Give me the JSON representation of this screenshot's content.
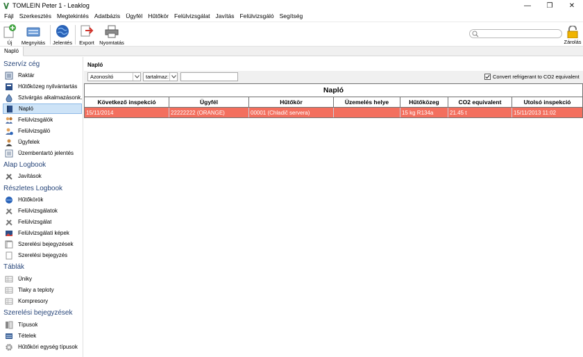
{
  "window": {
    "title": "TOMLEIN Peter 1 - Leaklog",
    "minimize": "—",
    "restore": "❐",
    "close": "✕"
  },
  "menu": [
    "Fájl",
    "Szerkesztés",
    "Megtekintés",
    "Adatbázis",
    "Ügyfél",
    "Hűtőkör",
    "Felülvizsgálat",
    "Javítás",
    "Felülvizsgáló",
    "Segítség"
  ],
  "toolbar": {
    "new_label": "Új",
    "open_label": "Megnyitás",
    "report_label": "Jelentés",
    "export_label": "Export",
    "print_label": "Nyomtatás",
    "lock_label": "Zárolás",
    "search_placeholder": ""
  },
  "doc_tab": "Napló",
  "sidebar": {
    "sections": [
      {
        "title": "Szervíz cég",
        "items": [
          "Raktár",
          "Hűtőközeg nyilvántartás",
          "Szivárgás alkalmazásonk...",
          "Napló",
          "Felülvizsgálók",
          "Felülvizsgáló",
          "Ügyfelek",
          "Üzembentartó jelentés"
        ]
      },
      {
        "title": "Alap Logbook",
        "items": [
          "Javítások"
        ]
      },
      {
        "title": "Részletes Logbook",
        "items": [
          "Hűtőkörök",
          "Felülvizsgálatok",
          "Felülvizsgálat",
          "Felülvizsgálati képek",
          "Szerelési bejegyzések",
          "Szerelési bejegyzés"
        ]
      },
      {
        "title": "Táblák",
        "items": [
          "Úniky",
          "Tlaky a teploty",
          "Kompresory"
        ]
      },
      {
        "title": "Szerelési bejegyzések",
        "items": [
          "Típusok",
          "Tételek",
          "Hűtőköri egység típusok"
        ]
      }
    ],
    "selected": "Napló"
  },
  "content": {
    "title": "Napló",
    "filter": {
      "field": "Azonosító",
      "operator": "tartalmaz:",
      "value": ""
    },
    "co2_checkbox_label": "Convert refrigerant to CO2 equivalent",
    "co2_checked": true,
    "grid_title": "Napló",
    "columns": [
      "Következő inspekció",
      "Ügyfél",
      "Hűtőkör",
      "Üzemelés helye",
      "Hűtőközeg",
      "CO2 equivalent",
      "Utolsó inspekció"
    ],
    "rows": [
      [
        "15/11/2014",
        "22222222 (ORANGE)",
        "00001 (Chladič servera)",
        "",
        "15 kg R134a",
        "21.45 t",
        "15/11/2013 11:02"
      ]
    ],
    "row_color": "#f36f5e"
  }
}
